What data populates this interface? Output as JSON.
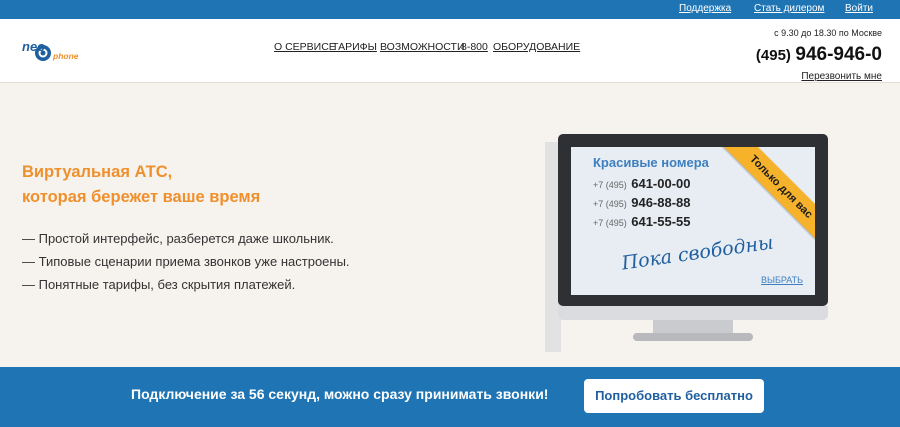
{
  "topbar": {
    "links": [
      {
        "label": "Поддержка"
      },
      {
        "label": "Стать дилером"
      },
      {
        "label": "Войти"
      }
    ]
  },
  "header": {
    "logo": {
      "text_neo": "neo",
      "text_phone": "phone"
    },
    "nav": [
      {
        "label": "О СЕРВИСЕ"
      },
      {
        "label": "ТАРИФЫ"
      },
      {
        "label": "ВОЗМОЖНОСТИ"
      },
      {
        "label": "8-800"
      },
      {
        "label": "ОБОРУДОВАНИЕ"
      }
    ],
    "hours": "с 9.30 до 18.30 по Москве",
    "phone_code": "(495)",
    "phone_number": "946-946-0",
    "callback": "Перезвонить мне"
  },
  "hero": {
    "title_line1": "Виртуальная АТС,",
    "title_line2": "которая бережет ваше время",
    "features": [
      "— Простой интерфейс, разберется даже школьник.",
      "— Типовые сценарии приема звонков уже настроены.",
      "— Понятные тарифы, без скрытия платежей."
    ]
  },
  "promo": {
    "title": "Красивые номера",
    "numbers": [
      {
        "prefix": "+7 (495)",
        "number": "641-00-00"
      },
      {
        "prefix": "+7 (495)",
        "number": "946-88-88"
      },
      {
        "prefix": "+7 (495)",
        "number": "641-55-55"
      }
    ],
    "script_text": "Пока свободны",
    "ribbon": "Только для вас",
    "choose": "ВЫБРАТЬ"
  },
  "cta": {
    "text": "Подключение за 56 секунд, можно сразу принимать звонки!",
    "button": "Попробовать бесплатно"
  },
  "colors": {
    "brand_blue": "#1f74b3",
    "accent_orange": "#f0902c",
    "ribbon_yellow": "#f6b22a",
    "background": "#f6f2ee"
  }
}
